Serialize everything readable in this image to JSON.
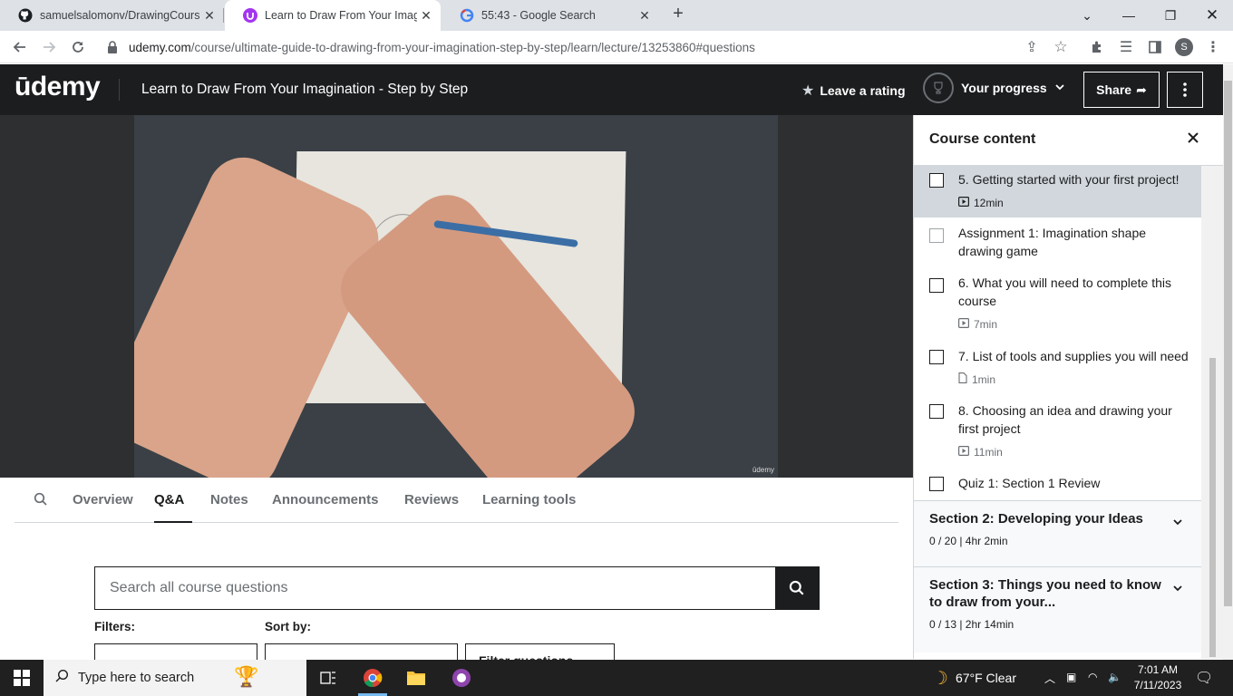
{
  "browser": {
    "tabs": [
      {
        "title": "samuelsalomonv/DrawingCourse",
        "icon": "github-icon"
      },
      {
        "title": "Learn to Draw From Your Imagina",
        "icon": "udemy-icon"
      },
      {
        "title": "55:43 - Google Search",
        "icon": "google-icon"
      }
    ],
    "url_host": "udemy.com",
    "url_path": "/course/ultimate-guide-to-drawing-from-your-imagination-step-by-step/learn/lecture/13253860#questions",
    "profile_initial": "S"
  },
  "header": {
    "logo": "ūdemy",
    "course_title": "Learn to Draw From Your Imagination - Step by Step",
    "rate_label": "Leave a rating",
    "progress_label": "Your progress",
    "share_label": "Share"
  },
  "video": {
    "watermark": "ūdemy"
  },
  "lecture_tabs": [
    "Overview",
    "Q&A",
    "Notes",
    "Announcements",
    "Reviews",
    "Learning tools"
  ],
  "qa": {
    "search_placeholder": "Search all course questions",
    "filters_label": "Filters:",
    "sort_label": "Sort by:",
    "filter_value": "",
    "sort_value": "",
    "third_value": "Filter questions"
  },
  "sidebar": {
    "title": "Course content",
    "items": [
      {
        "title": "5. Getting started with your first project!",
        "meta": "12min",
        "meta_icon": "video-icon"
      },
      {
        "title": "Assignment 1: Imagination shape drawing game",
        "meta": "",
        "meta_icon": ""
      },
      {
        "title": "6. What you will need to complete this course",
        "meta": "7min",
        "meta_icon": "video-icon"
      },
      {
        "title": "7. List of tools and supplies you will need",
        "meta": "1min",
        "meta_icon": "file-icon"
      },
      {
        "title": "8. Choosing an idea and drawing your first project",
        "meta": "11min",
        "meta_icon": "video-icon"
      },
      {
        "title": "Quiz 1: Section 1 Review",
        "meta": "",
        "meta_icon": ""
      }
    ],
    "sections": [
      {
        "title": "Section 2: Developing your Ideas",
        "sub": "0 / 20 | 4hr 2min"
      },
      {
        "title": "Section 3: Things you need to know to draw from your...",
        "sub": "0 / 13 | 2hr 14min"
      }
    ]
  },
  "taskbar": {
    "search_placeholder": "Type here to search",
    "weather": "67°F  Clear",
    "time": "7:01 AM",
    "date": "7/11/2023"
  },
  "colors": {
    "udemy_dark": "#1c1d1f",
    "active_item": "#d1d7dc",
    "taskbar": "#202020"
  }
}
